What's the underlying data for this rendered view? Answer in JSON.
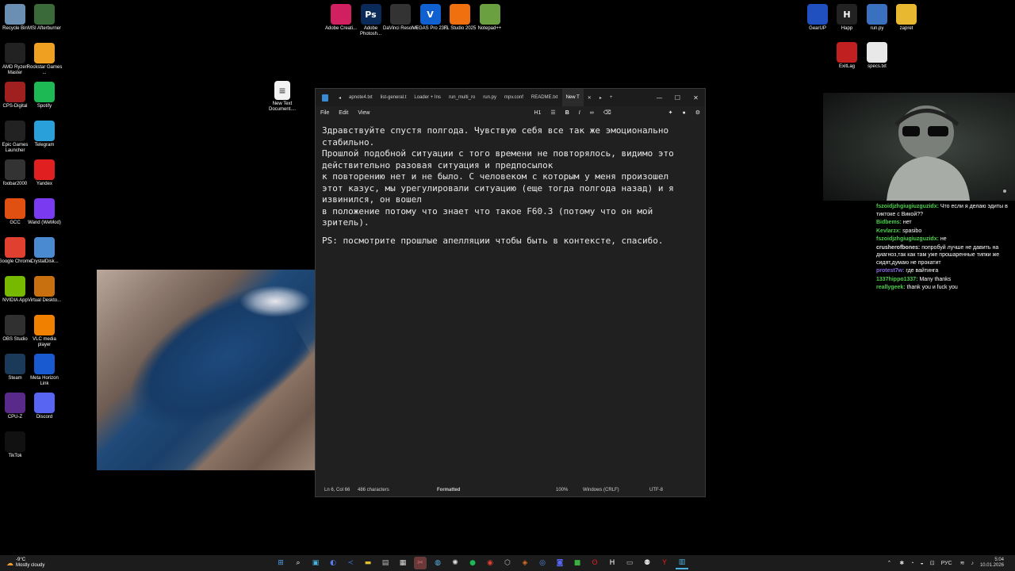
{
  "desktop_icons_left": [
    {
      "label": "Recycle Bin",
      "icon": "recycle-bin-icon",
      "color": "#6b8fb3"
    },
    {
      "label": "MSI Afterburner",
      "icon": "msi-afterburner-icon",
      "color": "#3a6a3a"
    },
    {
      "label": "AMD Ryzen Master",
      "icon": "amd-ryzen-icon",
      "color": "#222"
    },
    {
      "label": "Rockstar Games ...",
      "icon": "rockstar-icon",
      "color": "#f0a020"
    },
    {
      "label": "CPS-Digital",
      "icon": "cps-icon",
      "color": "#a02020"
    },
    {
      "label": "Spotify",
      "icon": "spotify-icon",
      "color": "#1db954"
    },
    {
      "label": "Epic Games Launcher",
      "icon": "epic-icon",
      "color": "#222"
    },
    {
      "label": "Telegram",
      "icon": "telegram-icon",
      "color": "#2aa0da"
    },
    {
      "label": "foobar2000",
      "icon": "foobar-icon",
      "color": "#333"
    },
    {
      "label": "Yandex",
      "icon": "yandex-icon",
      "color": "#e02020"
    },
    {
      "label": "GCC",
      "icon": "gcc-icon",
      "color": "#e05010"
    },
    {
      "label": "Wand (WeMod)",
      "icon": "wemod-icon",
      "color": "#7a3af0"
    },
    {
      "label": "Google Chrome",
      "icon": "chrome-icon",
      "color": "#e04030"
    },
    {
      "label": "CrystalDisk...",
      "icon": "crystaldisk-icon",
      "color": "#4a8ad0"
    },
    {
      "label": "NVIDIA App",
      "icon": "nvidia-icon",
      "color": "#76b900"
    },
    {
      "label": "Virtual Deskto...",
      "icon": "virtual-desktop-icon",
      "color": "#c87010"
    },
    {
      "label": "OBS Studio",
      "icon": "obs-icon",
      "color": "#303030"
    },
    {
      "label": "VLC media player",
      "icon": "vlc-icon",
      "color": "#f08000"
    },
    {
      "label": "Steam",
      "icon": "steam-icon",
      "color": "#1b3a5a"
    },
    {
      "label": "Meta Horizon Link",
      "icon": "meta-icon",
      "color": "#1a5ad0"
    },
    {
      "label": "CPU-Z",
      "icon": "cpuz-icon",
      "color": "#5a2a8a"
    },
    {
      "label": "Discord",
      "icon": "discord-icon",
      "color": "#5865f2"
    },
    {
      "label": "TikTok",
      "icon": "tiktok-icon",
      "color": "#111"
    }
  ],
  "desktop_icons_top": [
    {
      "label": "Adobe Creati...",
      "icon": "adobe-cc-icon",
      "color": "#d02060"
    },
    {
      "label": "Adobe Photosh...",
      "icon": "photoshop-icon",
      "color": "#0a2a5a",
      "glyph": "Ps"
    },
    {
      "label": "DaVinci Resolve",
      "icon": "davinci-icon",
      "color": "#333"
    },
    {
      "label": "VEGAS Pro 23.0",
      "icon": "vegas-icon",
      "color": "#1060d0",
      "glyph": "V"
    },
    {
      "label": "FL Studio 2025",
      "icon": "fl-studio-icon",
      "color": "#f07010"
    },
    {
      "label": "Notepad++",
      "icon": "notepadpp-icon",
      "color": "#6aa040"
    }
  ],
  "desktop_icons_right": [
    {
      "label": "GearUP",
      "icon": "gearup-icon",
      "color": "#2050c0"
    },
    {
      "label": "Happ",
      "icon": "happ-icon",
      "color": "#222",
      "glyph": "H"
    },
    {
      "label": "run.py",
      "icon": "python-file-icon",
      "color": "#3a70c0"
    },
    {
      "label": "zapret",
      "icon": "folder-icon",
      "color": "#e8b830"
    },
    {
      "label": "ExitLag",
      "icon": "exitlag-icon",
      "color": "#c02020"
    },
    {
      "label": "specs.txt",
      "icon": "text-file-icon",
      "color": "#e8e8e8"
    }
  ],
  "desktop_file": {
    "label": "New Text Document....",
    "icon": "text-file-icon"
  },
  "notepad": {
    "tabs": [
      "apnote4.txt",
      "list-general.t",
      "Loader + Ins",
      "run_multi_ro",
      "run.py",
      "mpv.conf",
      "README.txt",
      "New T"
    ],
    "menu": [
      "File",
      "Edit",
      "View"
    ],
    "toolbar": {
      "heading": "H1",
      "bold": "B"
    },
    "content_lines": [
      "Здравствуйте спустя полгода. Чувствую себя все так же эмоционально",
      "стабильно.",
      "Прошлой подобной ситуации с того времени не повторялось, видимо это",
      "действительно разовая ситуация и предпосылок",
      "к повторению нет и не было. С человеком с которым у меня произошел",
      "этот казус, мы урегулировали ситуацию (еще тогда полгода назад) и я",
      "извинился, он вошел",
      "в положение потому что знает что такое F60.3 (потому что он мой",
      "зритель).",
      "",
      "PS: посмотрите прошлые апелляции чтобы быть в контексте, спасибо."
    ],
    "status": {
      "position": "Ln 6, Col 66",
      "chars": "486 characters",
      "mode": "Formatted",
      "zoom": "100%",
      "eol": "Windows (CRLF)",
      "encoding": "UTF-8"
    }
  },
  "chat": [
    {
      "user": "fszoidjzhgiugiuzguzidx:",
      "text": "Что если я делаю эдиты в тиктоке с Викой??",
      "color": "#4ad04a"
    },
    {
      "user": "Bidbems:",
      "text": "нет",
      "color": "#4ad04a"
    },
    {
      "user": "Kevlarzx:",
      "text": "spasibo",
      "color": "#4ad04a"
    },
    {
      "user": "fszoidjzhgiugiuzguzidx:",
      "text": "не",
      "color": "#4ad04a"
    },
    {
      "user": "crusherofbones:",
      "text": "попробуй лучше не давить на диагноз,так как там уже прошаренные типки же сидят,думаю не прокатит",
      "color": "#e0e0e0"
    },
    {
      "user": "protest7w:",
      "text": "где вайтинга",
      "color": "#8a6ae0"
    },
    {
      "user": "1337hippo1337:",
      "text": "Many thanks",
      "color": "#4ad04a"
    },
    {
      "user": "reallygeek:",
      "text": "thank you и fuck you",
      "color": "#4ad04a"
    }
  ],
  "taskbar": {
    "weather_temp": "-9°C",
    "weather_desc": "Mostly cloudy",
    "lang": "РУС",
    "time": "5:04",
    "date": "10.01.2026"
  }
}
